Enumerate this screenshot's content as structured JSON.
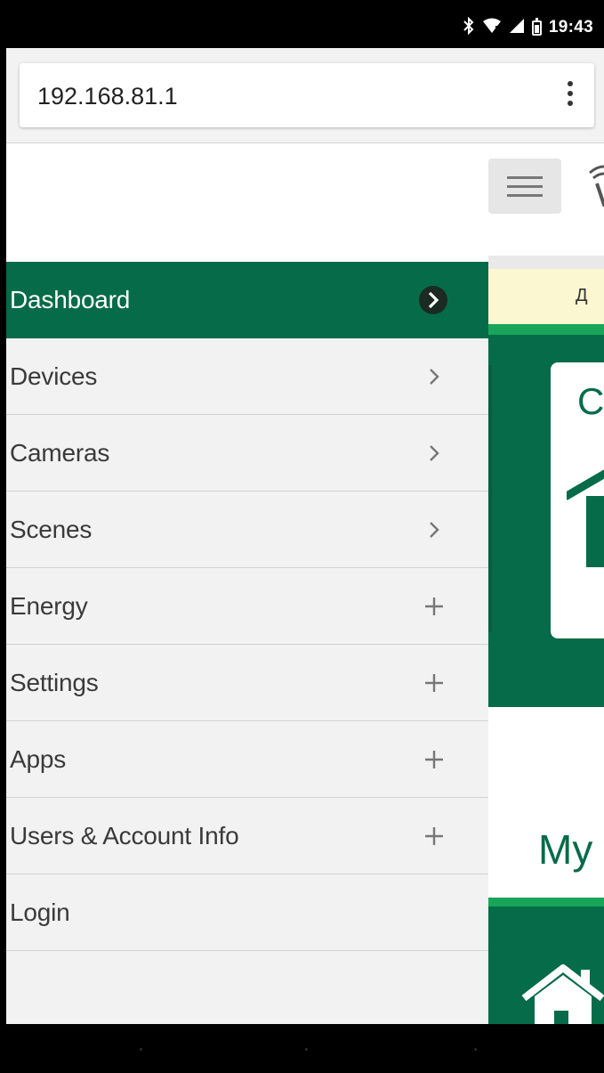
{
  "status_bar": {
    "time": "19:43",
    "icons": [
      "bluetooth-icon",
      "wifi-icon",
      "signal-icon",
      "battery-icon"
    ],
    "battery_level": "85"
  },
  "browser": {
    "url": "192.168.81.1",
    "menu_icon": "overflow-menu-icon"
  },
  "page": {
    "notice_text": "Д",
    "card_letter": "C",
    "heading_partial": "My"
  },
  "drawer": {
    "items": [
      {
        "label": "Dashboard",
        "trail": "chevron",
        "active": true
      },
      {
        "label": "Devices",
        "trail": "chevron",
        "active": false
      },
      {
        "label": "Cameras",
        "trail": "chevron",
        "active": false
      },
      {
        "label": "Scenes",
        "trail": "chevron",
        "active": false
      },
      {
        "label": "Energy",
        "trail": "plus",
        "active": false
      },
      {
        "label": "Settings",
        "trail": "plus",
        "active": false
      },
      {
        "label": "Apps",
        "trail": "plus",
        "active": false
      },
      {
        "label": "Users & Account Info",
        "trail": "plus",
        "active": false
      },
      {
        "label": "Login",
        "trail": "none",
        "active": false
      }
    ]
  },
  "colors": {
    "brand_green": "#066b48",
    "accent_green": "#18a55a",
    "drawer_bg": "#f2f2f2",
    "notice_bg": "#fbf7d0"
  }
}
